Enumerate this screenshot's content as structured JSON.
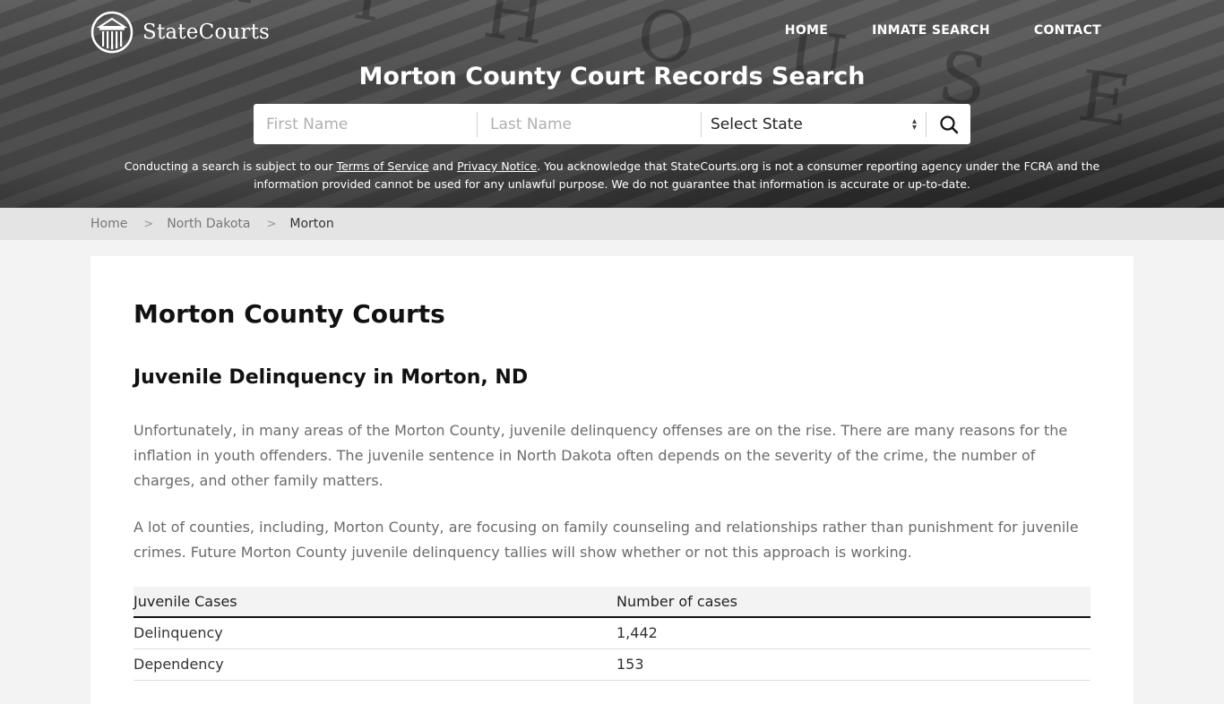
{
  "header": {
    "logo_text": "StateCourts",
    "nav": [
      {
        "label": "HOME"
      },
      {
        "label": "INMATE SEARCH"
      },
      {
        "label": "CONTACT"
      }
    ],
    "title": "Morton County Court Records Search",
    "background_letters": "R T H O U S E"
  },
  "search": {
    "first_name_placeholder": "First Name",
    "last_name_placeholder": "Last Name",
    "first_name_value": "",
    "last_name_value": "",
    "state_selected": "Select State",
    "search_icon": "search-icon"
  },
  "disclaimer": {
    "part1": "Conducting a search is subject to our ",
    "terms_link": "Terms of Service",
    "part2": " and ",
    "privacy_link": "Privacy Notice",
    "part3": ". You acknowledge that StateCourts.org is not a consumer reporting agency under the FCRA and the information provided cannot be used for any unlawful purpose. We do not guarantee that information is accurate or up-to-date."
  },
  "breadcrumb": [
    {
      "label": "Home"
    },
    {
      "label": "North Dakota"
    },
    {
      "label": "Morton"
    }
  ],
  "content": {
    "title": "Morton County Courts",
    "section_title": "Juvenile Delinquency in Morton, ND",
    "paragraph1": "Unfortunately, in many areas of the Morton County, juvenile delinquency offenses are on the rise. There are many reasons for the inflation in youth offenders. The juvenile sentence in North Dakota often depends on the severity of the crime, the number of charges, and other family matters.",
    "paragraph2": "A lot of counties, including, Morton County, are focusing on family counseling and relationships rather than punishment for juvenile crimes. Future Morton County juvenile delinquency tallies will show whether or not this approach is working.",
    "table": {
      "headers": [
        "Juvenile Cases",
        "Number of cases"
      ],
      "rows": [
        [
          "Delinquency",
          "1,442"
        ],
        [
          "Dependency",
          "153"
        ]
      ]
    }
  }
}
